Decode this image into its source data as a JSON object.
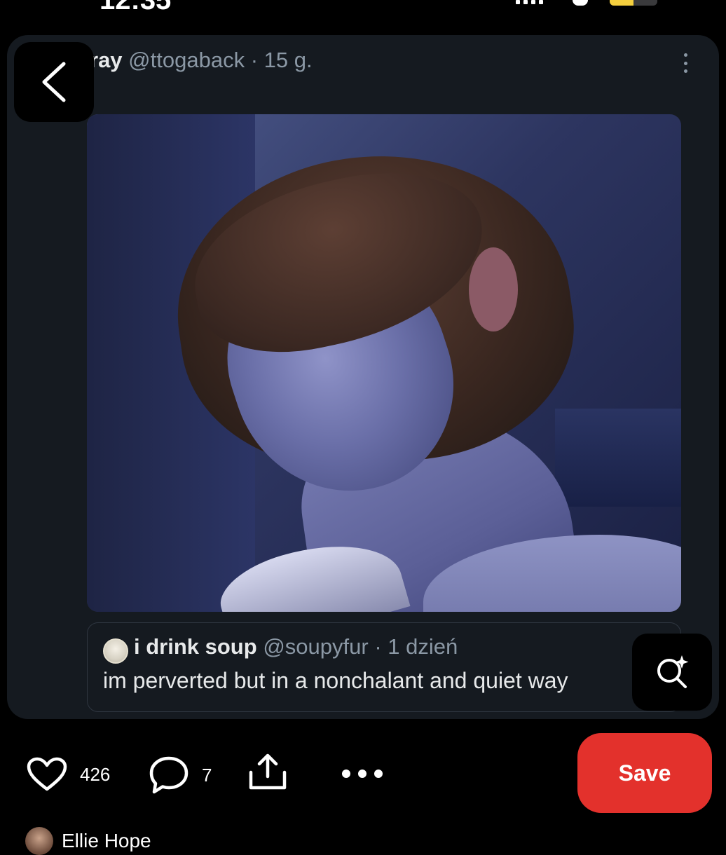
{
  "status_bar": {
    "time": "12:35"
  },
  "tweet": {
    "author_name": "ray",
    "author_handle": "@ttogaback",
    "meta_separator": "·",
    "timestamp": "15 g.",
    "quote": {
      "author_name": "i drink soup",
      "author_handle": "@soupyfur",
      "meta_separator": "·",
      "timestamp": "1 dzień",
      "text": "im perverted but in a nonchalant and quiet way"
    }
  },
  "actions": {
    "likes_count": "426",
    "comments_count": "7",
    "save_label": "Save"
  },
  "pinner": {
    "name": "Ellie Hope"
  },
  "icons": {
    "back": "chevron-left-icon",
    "more": "kebab-icon",
    "visual_search": "visual-search-icon",
    "like": "heart-icon",
    "comment": "comment-icon",
    "share": "share-icon",
    "options": "more-horizontal-icon"
  },
  "colors": {
    "background": "#000000",
    "card": "#151a20",
    "save_button": "#e3312c",
    "secondary_text": "#8b98a5"
  }
}
